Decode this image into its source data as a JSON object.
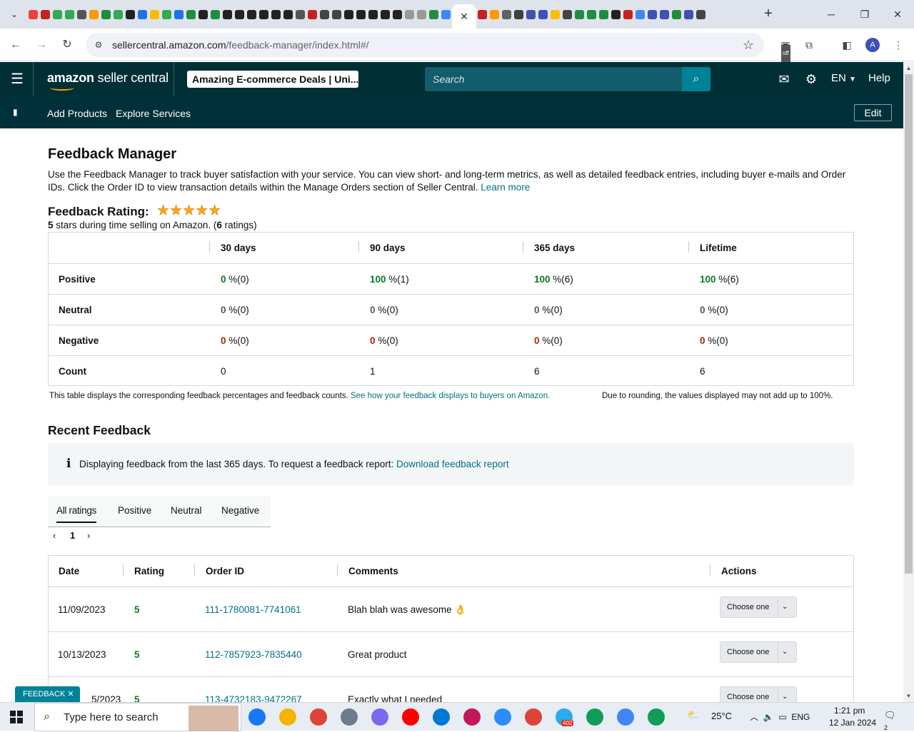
{
  "browser": {
    "url_domain": "sellercentral.amazon.com",
    "url_path": "/feedback-manager/index.html#/",
    "profile_initial": "A",
    "extension_badge": "off"
  },
  "header": {
    "logo_brand": "amazon",
    "logo_product": "seller central",
    "store": "Amazing E-commerce Deals | Uni...",
    "search_placeholder": "Search",
    "language": "EN",
    "help": "Help"
  },
  "nav": {
    "items": [
      "Add Products",
      "Explore Services"
    ],
    "edit": "Edit"
  },
  "page": {
    "title": "Feedback Manager",
    "intro": "Use the Feedback Manager to track buyer satisfaction with your service. You can view short- and long-term metrics, as well as detailed feedback entries, including buyer e-mails and Order IDs. Click the Order ID to view transaction details within the Manage Orders section of Seller Central.",
    "learn_more": "Learn more",
    "rating_label": "Feedback Rating:",
    "stars": 5,
    "rating_sub_value": "5",
    "rating_sub_text1": " stars during time selling on Amazon. (",
    "rating_sub_count": "6",
    "rating_sub_text2": " ratings)"
  },
  "metrics": {
    "columns": [
      "30 days",
      "90 days",
      "365 days",
      "Lifetime"
    ],
    "rows": [
      {
        "label": "Positive",
        "cells": [
          [
            "0",
            " %(0)"
          ],
          [
            "100",
            " %(1)"
          ],
          [
            "100",
            " %(6)"
          ],
          [
            "100",
            " %(6)"
          ]
        ]
      },
      {
        "label": "Neutral",
        "cells": [
          [
            "0",
            " %(0)"
          ],
          [
            "0",
            " %(0)"
          ],
          [
            "0",
            " %(0)"
          ],
          [
            "0",
            " %(0)"
          ]
        ]
      },
      {
        "label": "Negative",
        "cells": [
          [
            "0",
            " %(0)"
          ],
          [
            "0",
            " %(0)"
          ],
          [
            "0",
            " %(0)"
          ],
          [
            "0",
            " %(0)"
          ]
        ]
      },
      {
        "label": "Count",
        "cells": [
          [
            "0",
            ""
          ],
          [
            "1",
            ""
          ],
          [
            "6",
            ""
          ],
          [
            "6",
            ""
          ]
        ]
      }
    ],
    "note_text": "This table displays the corresponding feedback percentages and feedback counts. ",
    "note_link": "See how your feedback displays to buyers on Amazon.",
    "note_rounding": "Due to rounding, the values displayed may not add up to 100%."
  },
  "recent": {
    "title": "Recent Feedback",
    "info_text": "Displaying feedback from the last 365 days. To request a feedback report: ",
    "info_link": "Download feedback report",
    "tabs": [
      "All ratings",
      "Positive",
      "Neutral",
      "Negative"
    ],
    "page": "1",
    "columns": [
      "Date",
      "Rating",
      "Order ID",
      "Comments",
      "Actions"
    ],
    "rows": [
      {
        "date": "11/09/2023",
        "rating": "5",
        "order": "111-1780081-7741061",
        "comment": "Blah blah was awesome 👌",
        "action": "Choose one"
      },
      {
        "date": "10/13/2023",
        "rating": "5",
        "order": "112-7857923-7835440",
        "comment": "Great product",
        "action": "Choose one"
      },
      {
        "date": "5/2023",
        "rating": "5",
        "order": "113-4732183-9472267",
        "comment": "Exactly what I needed",
        "action": "Choose one"
      }
    ],
    "feedback_tab": "FEEDBACK ✕"
  },
  "taskbar": {
    "search_placeholder": "Type here to search",
    "temperature": "25°C",
    "language": "ENG",
    "time": "1:21 pm",
    "date": "12 Jan 2024",
    "telegram_badge": "402",
    "notif_count": "2"
  }
}
